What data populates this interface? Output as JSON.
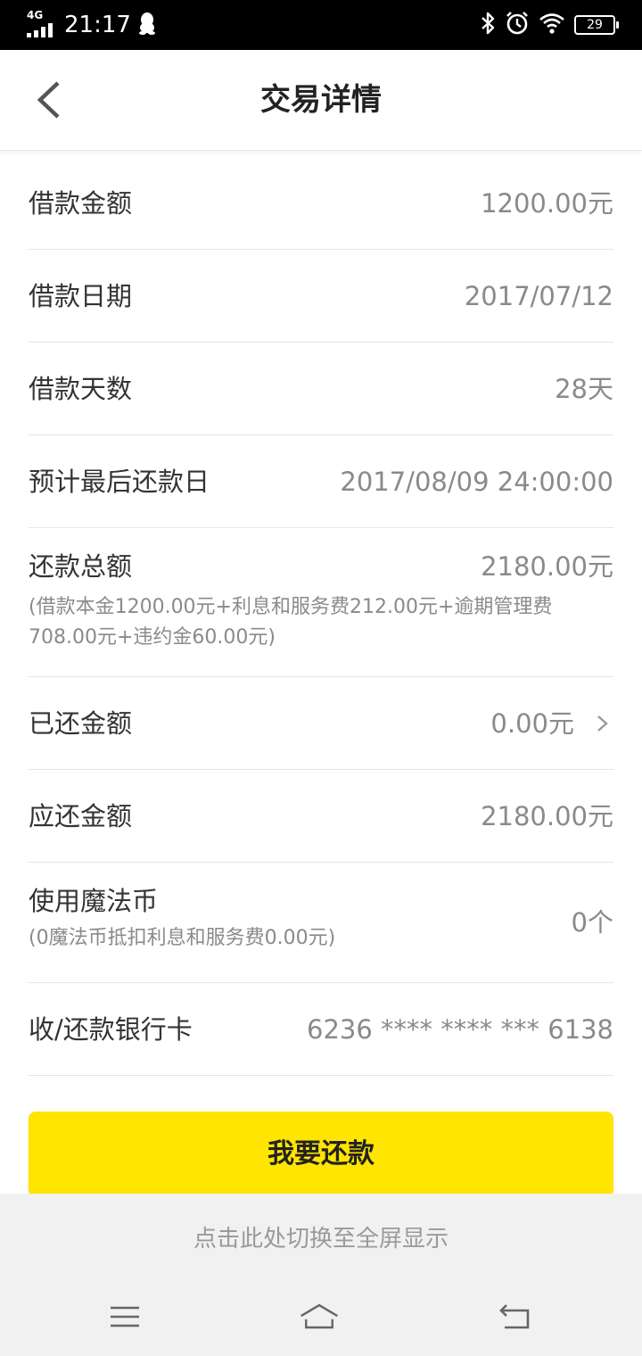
{
  "status_bar": {
    "network": "4G",
    "time": "21:17",
    "battery": "29",
    "icons": [
      "signal-icon",
      "qq-icon",
      "bluetooth-icon",
      "alarm-icon",
      "wifi-icon",
      "battery-icon"
    ]
  },
  "header": {
    "title": "交易详情"
  },
  "rows": {
    "loan_amount": {
      "label": "借款金额",
      "value": "1200.00元"
    },
    "loan_date": {
      "label": "借款日期",
      "value": "2017/07/12"
    },
    "loan_days": {
      "label": "借款天数",
      "value": "28天"
    },
    "due_date": {
      "label": "预计最后还款日",
      "value": "2017/08/09 24:00:00"
    },
    "total_repay": {
      "label": "还款总额",
      "value": "2180.00元",
      "note": "(借款本金1200.00元+利息和服务费212.00元+逾期管理费708.00元+违约金60.00元)"
    },
    "repaid": {
      "label": "已还金额",
      "value": "0.00元"
    },
    "due_amount": {
      "label": "应还金额",
      "value": "2180.00元"
    },
    "magic_coins": {
      "label": "使用魔法币",
      "value": "0个",
      "note": "(0魔法币抵扣利息和服务费0.00元)"
    },
    "bank_card": {
      "label": "收/还款银行卡",
      "value": "6236 **** **** *** 6138"
    }
  },
  "repay_button": {
    "label": "我要还款"
  },
  "fullscreen_tip": "点击此处切换至全屏显示",
  "colors": {
    "accent": "#ffe500",
    "status_bar": "#000000",
    "label_text": "#333333",
    "value_text": "#8a8a8a"
  }
}
